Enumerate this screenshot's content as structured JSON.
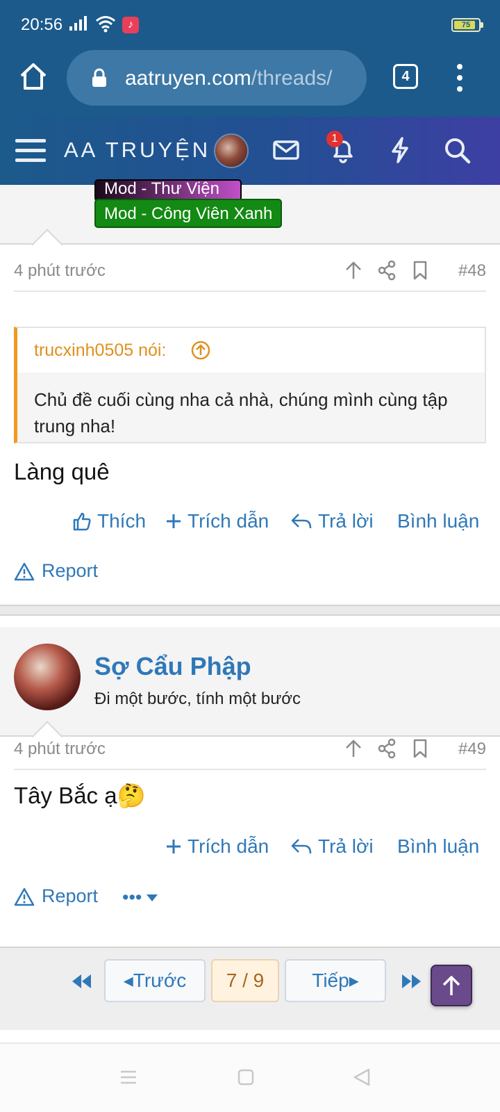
{
  "status_bar": {
    "time": "20:56",
    "battery": "75"
  },
  "browser": {
    "url_host": "aatruyen.com",
    "url_path": "/threads/",
    "tab_count": "4"
  },
  "site_header": {
    "logo": "AA TRUYỆN",
    "notification_count": "1"
  },
  "prev_post": {
    "badges": [
      "Mod - Thư Viện",
      "Mod - Công Viên Xanh"
    ],
    "time": "4 phút trước",
    "number": "#48",
    "quote": {
      "author": "trucxinh0505 nói:",
      "text": "Chủ đề cuối cùng nha cả nhà, chúng mình cùng tập trung nha!"
    },
    "body": "Làng quê",
    "actions": {
      "like": "Thích",
      "quote": "Trích dẫn",
      "reply": "Trả lời",
      "comment": "Bình luận"
    },
    "report": "Report"
  },
  "post": {
    "username": "Sợ Cẩu Phập",
    "user_title": "Đi một bước, tính một bước",
    "time": "4 phút trước",
    "number": "#49",
    "body": "Tây Bắc ạ🤔",
    "actions": {
      "quote": "Trích dẫn",
      "reply": "Trả lời",
      "comment": "Bình luận"
    },
    "report": "Report",
    "more": "•••"
  },
  "pagination": {
    "prev": "Trước",
    "current": "7 / 9",
    "next": "Tiếp"
  },
  "colors": {
    "chrome": "#1c5a8b",
    "link": "#2f78b8",
    "quote_accent": "#f09a1e",
    "badge_green": "#138a13"
  }
}
